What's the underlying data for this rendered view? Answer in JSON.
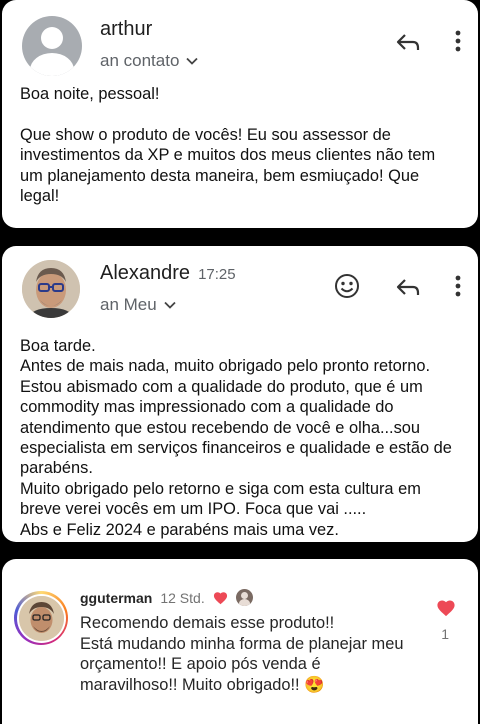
{
  "email1": {
    "sender": "arthur",
    "to": "an contato",
    "body": "Boa noite, pessoal!\n\nQue show o produto de vocês! Eu sou assessor de investimentos da XP e muitos dos meus clientes não tem um planejamento desta maneira, bem esmiuçado! Que legal!",
    "icons": [
      "default-avatar-icon",
      "chevron-down-icon",
      "reply-icon",
      "more-vert-icon"
    ]
  },
  "email2": {
    "sender": "Alexandre",
    "time": "17:25",
    "to": "an Meu",
    "body": "Boa tarde.\nAntes de mais nada, muito obrigado pelo pronto retorno.\nEstou abismado com a qualidade do produto, que é um commodity mas impressionado com a qualidade do atendimento que estou recebendo de você e olha...sou especialista em serviços financeiros e qualidade e estão de parabéns.\nMuito obrigado pelo retorno e siga com esta cultura em breve verei vocês em um IPO. Foca que vai .....\nAbs e Feliz 2024 e parabéns mais uma vez.",
    "icons": [
      "emoji-icon",
      "reply-icon",
      "more-vert-icon",
      "chevron-down-icon"
    ]
  },
  "comment": {
    "username": "gguterman",
    "time": "12 Std.",
    "text": "Recomendo demais esse produto!!\nEstá mudando minha forma de planejar meu orçamento!! E apoio pós venda é maravilhoso!! Muito obrigado!! 😍",
    "likes": "1",
    "colors": {
      "heart": "#ed4956"
    },
    "icons": [
      "heart-icon",
      "like-heart-icon"
    ]
  },
  "colors": {
    "background": "#000000",
    "card": "#ffffff",
    "secondary_text": "#5f6368"
  }
}
